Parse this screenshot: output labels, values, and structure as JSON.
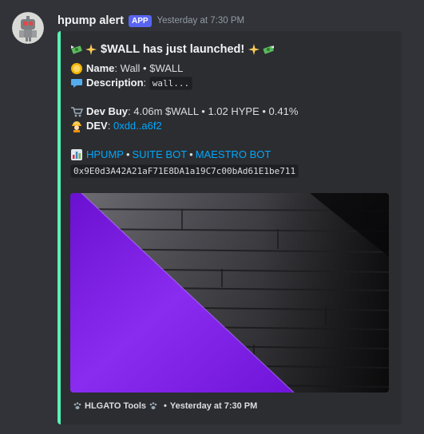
{
  "author": {
    "username": "hpump alert",
    "badge": "APP",
    "timestamp": "Yesterday at 7:30 PM"
  },
  "embed": {
    "accent_color": "#57f2b6",
    "title": "$WALL has just launched!",
    "name_label": "Name",
    "name_value": "Wall • $WALL",
    "description_label": "Description",
    "description_value": "wall...",
    "dev_buy_label": "Dev Buy",
    "dev_buy_value": "4.06m $WALL • 1.02 HYPE • 0.41%",
    "dev_label": "DEV",
    "dev_value": "0xdd..a6f2",
    "links": {
      "hpump": "HPUMP",
      "suite_bot": "SUITE BOT",
      "maestro_bot": "MAESTRO BOT",
      "separator": "•"
    },
    "contract_address": "0x9E0d3A42A21aF71E8DA1a19C7c00bAd61E1be711",
    "footer_text": "HLGATO Tools",
    "footer_timestamp": "Yesterday at 7:30 PM"
  },
  "icons": {
    "title_left": "money-with-wings-sparkles-icon",
    "title_right": "sparkles-money-with-wings-icon",
    "name": "coin-icon",
    "description": "speech-bubble-icon",
    "dev_buy": "shopping-cart-icon",
    "dev": "construction-worker-icon",
    "links": "bar-chart-icon",
    "footer": "paw-prints-icon"
  },
  "colors": {
    "background": "#313338",
    "embed_background": "#2b2d31",
    "link": "#00a8fc",
    "badge": "#5865f2",
    "image_purple": "#7a17e0"
  }
}
